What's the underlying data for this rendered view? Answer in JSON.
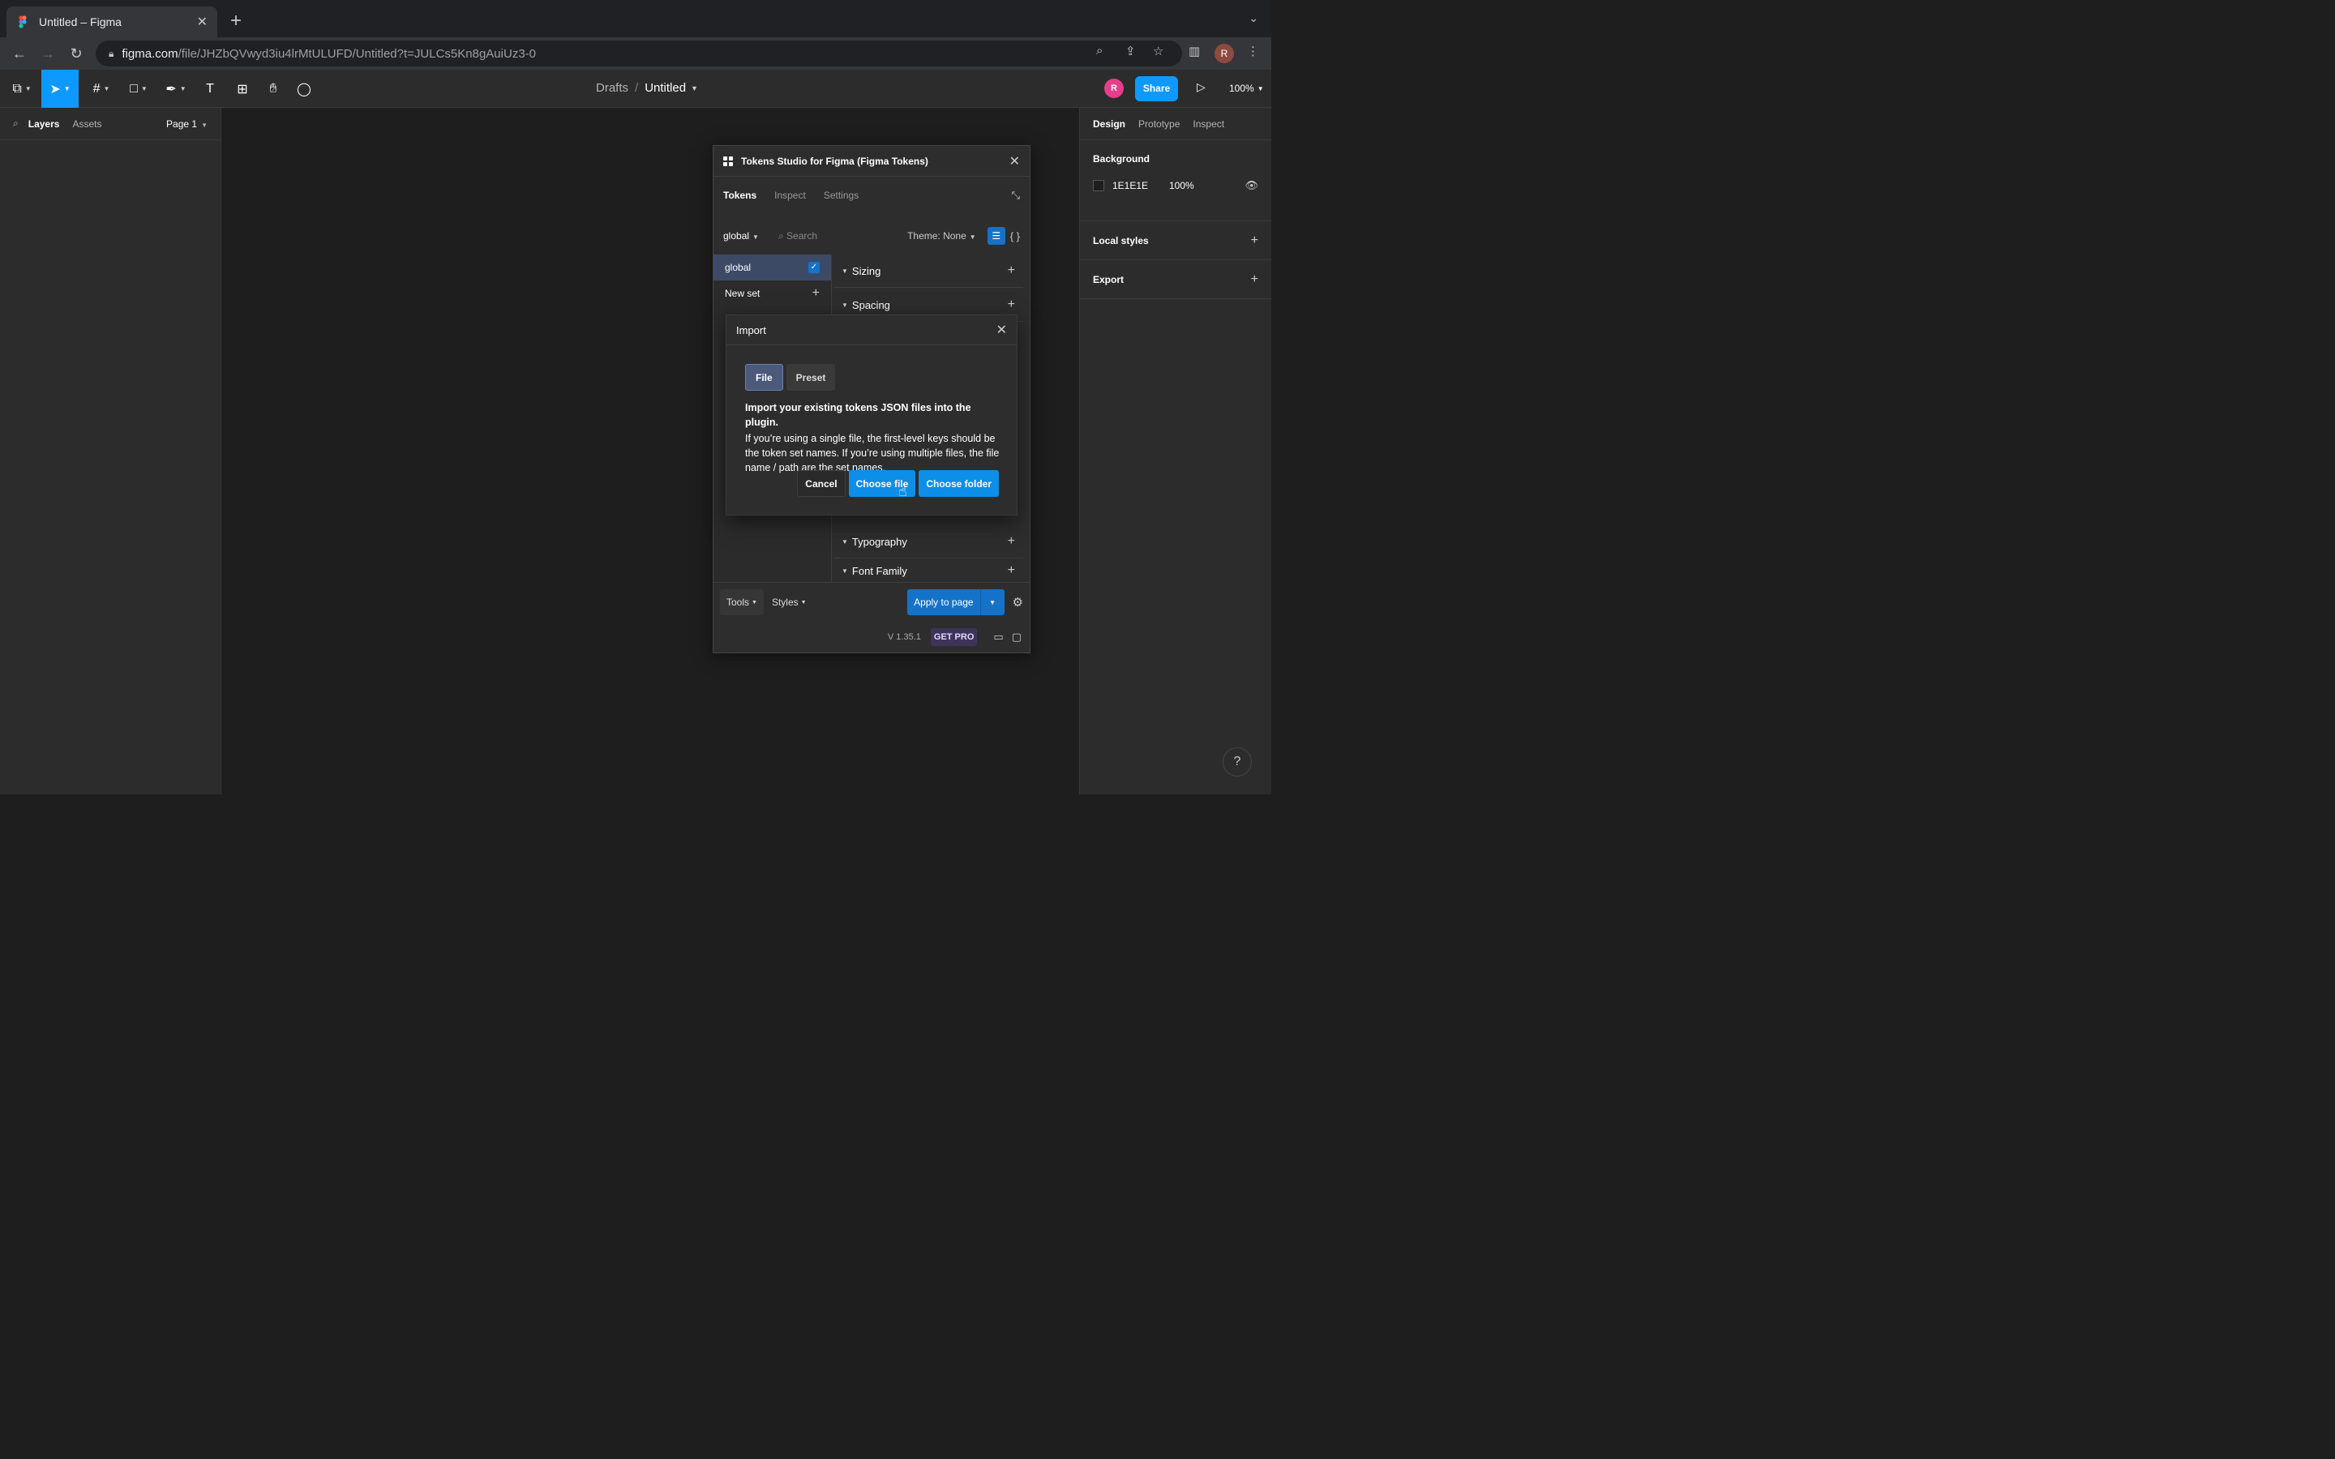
{
  "browser": {
    "tab_title": "Untitled – Figma",
    "url_host": "figma.com",
    "url_path": "/file/JHZbQVwyd3iu4lrMtULUFD/Untitled?t=JULCs5Kn8gAuiUz3-0",
    "profile_initial": "R"
  },
  "toolbar": {
    "breadcrumb_root": "Drafts",
    "breadcrumb_sep": "/",
    "file_name": "Untitled",
    "user_initial": "R",
    "share_label": "Share",
    "zoom": "100%"
  },
  "left_panel": {
    "tab_layers": "Layers",
    "tab_assets": "Assets",
    "page": "Page 1"
  },
  "right_panel": {
    "tabs": [
      "Design",
      "Prototype",
      "Inspect"
    ],
    "background_label": "Background",
    "background_hex": "1E1E1E",
    "background_opacity": "100%",
    "local_styles_label": "Local styles",
    "export_label": "Export"
  },
  "plugin": {
    "title": "Tokens Studio for Figma (Figma Tokens)",
    "tabs": [
      "Tokens",
      "Inspect",
      "Settings"
    ],
    "set_selector": "global",
    "search_placeholder": "Search",
    "theme": "Theme: None",
    "sets": [
      {
        "name": "global",
        "checked": true
      },
      {
        "name": "New set"
      }
    ],
    "groups": [
      "Sizing",
      "Spacing",
      "Typography",
      "Font Family"
    ],
    "footer": {
      "tools": "Tools",
      "styles": "Styles",
      "apply": "Apply to page",
      "version": "V 1.35.1",
      "get_pro": "GET PRO"
    }
  },
  "import_modal": {
    "title": "Import",
    "tabs": [
      "File",
      "Preset"
    ],
    "text_strong": "Import your existing tokens JSON files into the plugin.",
    "text_body": "If you’re using a single file, the first-level keys should be the token set names. If you’re using multiple files, the file name / path are the set names.",
    "cancel": "Cancel",
    "choose_file": "Choose file",
    "choose_folder": "Choose folder"
  }
}
